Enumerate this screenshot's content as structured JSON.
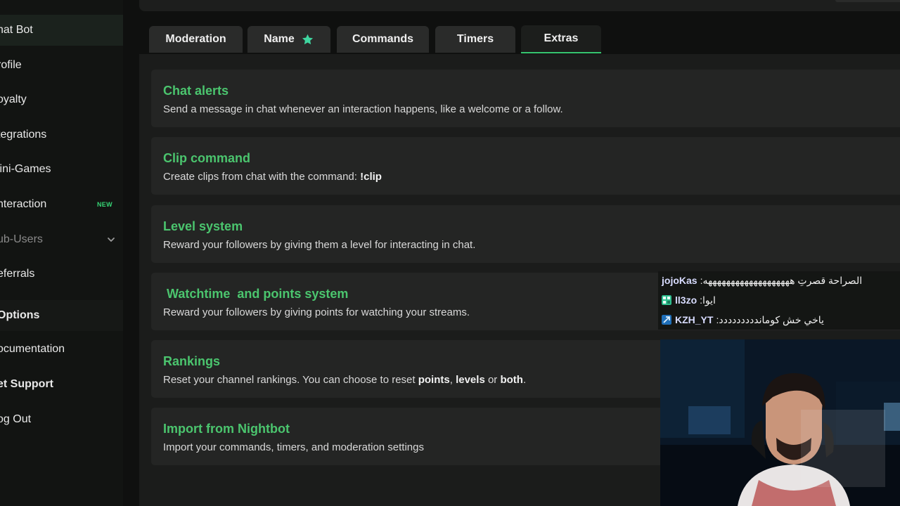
{
  "sidebar": {
    "items": [
      {
        "label": "hat Bot"
      },
      {
        "label": "rofile"
      },
      {
        "label": "oyalty"
      },
      {
        "label": "tegrations"
      },
      {
        "label": "lini-Games"
      },
      {
        "label": "nteraction",
        "badge": "NEW"
      },
      {
        "label": "ub-Users"
      },
      {
        "label": "eferrals"
      },
      {
        "label": "Options"
      },
      {
        "label": "ocumentation"
      },
      {
        "label": "et Support"
      },
      {
        "label": "og Out"
      }
    ]
  },
  "tabs": [
    {
      "label": "Moderation"
    },
    {
      "label": "Name",
      "icon": "star-icon"
    },
    {
      "label": "Commands"
    },
    {
      "label": "Timers"
    },
    {
      "label": "Extras",
      "active": true
    }
  ],
  "cards": [
    {
      "title": "Chat alerts",
      "desc": "Send a message in chat whenever an interaction happens, like a welcome or a follow."
    },
    {
      "title": "Clip command",
      "desc_prefix": "Create clips from chat with the command: ",
      "desc_bold": "!clip"
    },
    {
      "title": "Level system",
      "desc": "Reward your followers by giving them a level for interacting in chat."
    },
    {
      "title": " Watchtime  and points system",
      "desc": "Reward your followers by giving points for watching your streams."
    },
    {
      "title": "Rankings",
      "desc_parts": [
        "Reset your channel rankings. You can choose to reset ",
        "points",
        ", ",
        "levels",
        " or ",
        "both",
        "."
      ]
    },
    {
      "title": "Import from Nightbot",
      "desc": "Import your commands, timers, and moderation settings"
    }
  ],
  "chat": [
    {
      "user": "jojoKas",
      "sep": " : ",
      "message": "الصراحة قصرتِ هههههههههههههههههههه"
    },
    {
      "user": "ll3zo",
      "sep": " : ",
      "message": "ايوا"
    },
    {
      "user": "KZH_YT",
      "sep": " : ",
      "message": "ياخي خش كومانددددددددد"
    }
  ],
  "colors": {
    "accent": "#4bc56e",
    "badge_new": "#36d474"
  }
}
